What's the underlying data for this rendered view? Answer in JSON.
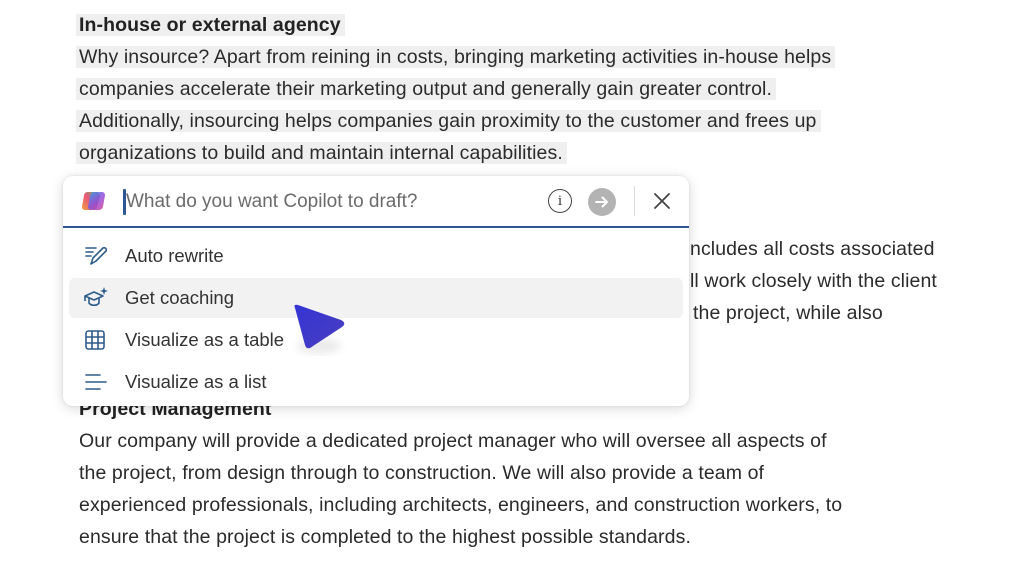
{
  "document": {
    "section1": {
      "heading": "In-house or external agency",
      "lines": [
        "Why insource? Apart from reining in costs, bringing marketing activities in-house helps",
        "companies accelerate their marketing output and generally gain greater control.",
        "Additionally, insourcing helps companies gain proximity to the customer and frees up",
        "organizations to build and maintain internal capabilities."
      ]
    },
    "partially_hidden_lines": [
      "ncludes all costs associated",
      "ll work closely with the client",
      "the project, while also"
    ],
    "section2": {
      "heading": "Project Management",
      "lines": [
        "Our company will provide a dedicated project manager who will oversee all aspects of",
        "the project, from design through to construction. We will also provide a team of",
        "experienced professionals, including architects, engineers, and construction workers, to",
        "ensure that the project is completed to the highest possible standards."
      ]
    }
  },
  "copilot_popup": {
    "logo_icon": "copilot-logo-icon",
    "input": {
      "placeholder": "What do you want Copilot to draft?",
      "value": ""
    },
    "info_icon": "info-icon",
    "send_icon": "arrow-right-icon",
    "close_icon": "close-icon",
    "accent_color": "#2f5597",
    "menu_items": [
      {
        "label": "Auto rewrite",
        "icon": "pen-lines-icon",
        "active": false
      },
      {
        "label": "Get coaching",
        "icon": "graduation-cap-sparkle-icon",
        "active": true
      },
      {
        "label": "Visualize as a table",
        "icon": "table-grid-icon",
        "active": false
      },
      {
        "label": "Visualize as a list",
        "icon": "list-lines-icon",
        "active": false
      }
    ]
  },
  "pointer": {
    "icon": "pointer-cursor-icon",
    "color": "#3b3bd0"
  }
}
